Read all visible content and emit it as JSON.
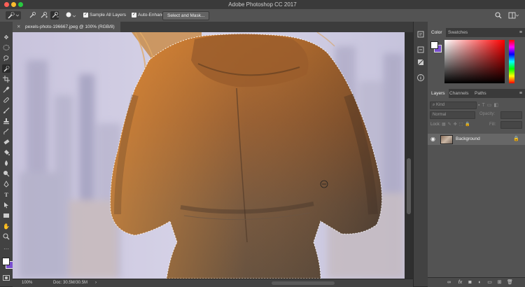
{
  "window": {
    "title": "Adobe Photoshop CC 2017"
  },
  "options_bar": {
    "sample_all_layers_label": "Sample All Layers",
    "auto_enhance_label": "Auto-Enhance",
    "select_and_mask_label": "Select and Mask..."
  },
  "document": {
    "tab_label": "pexels-photo-196667.jpeg @ 100% (RGB/8)"
  },
  "status_bar": {
    "zoom": "100%",
    "doc_info": "Doc: 30.5M/30.5M"
  },
  "panels": {
    "color_tabs": [
      "Color",
      "Swatches"
    ],
    "layer_tabs": [
      "Layers",
      "Channels",
      "Paths"
    ],
    "layers_filter_placeholder": "Kind",
    "blend_mode": "Normal",
    "opacity_label": "Opacity:",
    "lock_label": "Lock:",
    "fill_label": "Fill:",
    "layer_name": "Background"
  },
  "colors": {
    "foreground": "#ffffff",
    "background": "#7a4fd0",
    "accent": "#2d8ceb"
  }
}
